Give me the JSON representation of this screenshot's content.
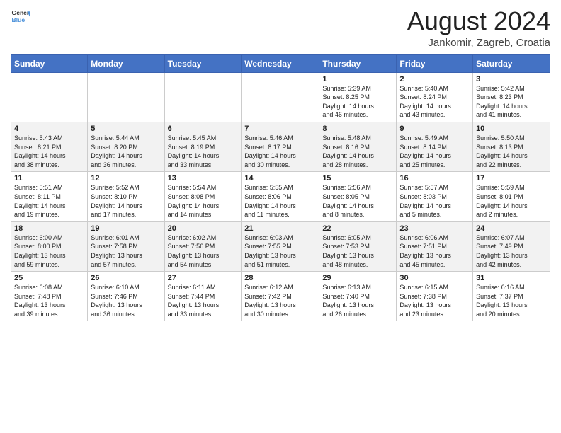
{
  "header": {
    "logo_line1": "General",
    "logo_line2": "Blue",
    "month_year": "August 2024",
    "location": "Jankomir, Zagreb, Croatia"
  },
  "days_of_week": [
    "Sunday",
    "Monday",
    "Tuesday",
    "Wednesday",
    "Thursday",
    "Friday",
    "Saturday"
  ],
  "weeks": [
    [
      {
        "day": "",
        "info": ""
      },
      {
        "day": "",
        "info": ""
      },
      {
        "day": "",
        "info": ""
      },
      {
        "day": "",
        "info": ""
      },
      {
        "day": "1",
        "info": "Sunrise: 5:39 AM\nSunset: 8:25 PM\nDaylight: 14 hours\nand 46 minutes."
      },
      {
        "day": "2",
        "info": "Sunrise: 5:40 AM\nSunset: 8:24 PM\nDaylight: 14 hours\nand 43 minutes."
      },
      {
        "day": "3",
        "info": "Sunrise: 5:42 AM\nSunset: 8:23 PM\nDaylight: 14 hours\nand 41 minutes."
      }
    ],
    [
      {
        "day": "4",
        "info": "Sunrise: 5:43 AM\nSunset: 8:21 PM\nDaylight: 14 hours\nand 38 minutes."
      },
      {
        "day": "5",
        "info": "Sunrise: 5:44 AM\nSunset: 8:20 PM\nDaylight: 14 hours\nand 36 minutes."
      },
      {
        "day": "6",
        "info": "Sunrise: 5:45 AM\nSunset: 8:19 PM\nDaylight: 14 hours\nand 33 minutes."
      },
      {
        "day": "7",
        "info": "Sunrise: 5:46 AM\nSunset: 8:17 PM\nDaylight: 14 hours\nand 30 minutes."
      },
      {
        "day": "8",
        "info": "Sunrise: 5:48 AM\nSunset: 8:16 PM\nDaylight: 14 hours\nand 28 minutes."
      },
      {
        "day": "9",
        "info": "Sunrise: 5:49 AM\nSunset: 8:14 PM\nDaylight: 14 hours\nand 25 minutes."
      },
      {
        "day": "10",
        "info": "Sunrise: 5:50 AM\nSunset: 8:13 PM\nDaylight: 14 hours\nand 22 minutes."
      }
    ],
    [
      {
        "day": "11",
        "info": "Sunrise: 5:51 AM\nSunset: 8:11 PM\nDaylight: 14 hours\nand 19 minutes."
      },
      {
        "day": "12",
        "info": "Sunrise: 5:52 AM\nSunset: 8:10 PM\nDaylight: 14 hours\nand 17 minutes."
      },
      {
        "day": "13",
        "info": "Sunrise: 5:54 AM\nSunset: 8:08 PM\nDaylight: 14 hours\nand 14 minutes."
      },
      {
        "day": "14",
        "info": "Sunrise: 5:55 AM\nSunset: 8:06 PM\nDaylight: 14 hours\nand 11 minutes."
      },
      {
        "day": "15",
        "info": "Sunrise: 5:56 AM\nSunset: 8:05 PM\nDaylight: 14 hours\nand 8 minutes."
      },
      {
        "day": "16",
        "info": "Sunrise: 5:57 AM\nSunset: 8:03 PM\nDaylight: 14 hours\nand 5 minutes."
      },
      {
        "day": "17",
        "info": "Sunrise: 5:59 AM\nSunset: 8:01 PM\nDaylight: 14 hours\nand 2 minutes."
      }
    ],
    [
      {
        "day": "18",
        "info": "Sunrise: 6:00 AM\nSunset: 8:00 PM\nDaylight: 13 hours\nand 59 minutes."
      },
      {
        "day": "19",
        "info": "Sunrise: 6:01 AM\nSunset: 7:58 PM\nDaylight: 13 hours\nand 57 minutes."
      },
      {
        "day": "20",
        "info": "Sunrise: 6:02 AM\nSunset: 7:56 PM\nDaylight: 13 hours\nand 54 minutes."
      },
      {
        "day": "21",
        "info": "Sunrise: 6:03 AM\nSunset: 7:55 PM\nDaylight: 13 hours\nand 51 minutes."
      },
      {
        "day": "22",
        "info": "Sunrise: 6:05 AM\nSunset: 7:53 PM\nDaylight: 13 hours\nand 48 minutes."
      },
      {
        "day": "23",
        "info": "Sunrise: 6:06 AM\nSunset: 7:51 PM\nDaylight: 13 hours\nand 45 minutes."
      },
      {
        "day": "24",
        "info": "Sunrise: 6:07 AM\nSunset: 7:49 PM\nDaylight: 13 hours\nand 42 minutes."
      }
    ],
    [
      {
        "day": "25",
        "info": "Sunrise: 6:08 AM\nSunset: 7:48 PM\nDaylight: 13 hours\nand 39 minutes."
      },
      {
        "day": "26",
        "info": "Sunrise: 6:10 AM\nSunset: 7:46 PM\nDaylight: 13 hours\nand 36 minutes."
      },
      {
        "day": "27",
        "info": "Sunrise: 6:11 AM\nSunset: 7:44 PM\nDaylight: 13 hours\nand 33 minutes."
      },
      {
        "day": "28",
        "info": "Sunrise: 6:12 AM\nSunset: 7:42 PM\nDaylight: 13 hours\nand 30 minutes."
      },
      {
        "day": "29",
        "info": "Sunrise: 6:13 AM\nSunset: 7:40 PM\nDaylight: 13 hours\nand 26 minutes."
      },
      {
        "day": "30",
        "info": "Sunrise: 6:15 AM\nSunset: 7:38 PM\nDaylight: 13 hours\nand 23 minutes."
      },
      {
        "day": "31",
        "info": "Sunrise: 6:16 AM\nSunset: 7:37 PM\nDaylight: 13 hours\nand 20 minutes."
      }
    ]
  ]
}
